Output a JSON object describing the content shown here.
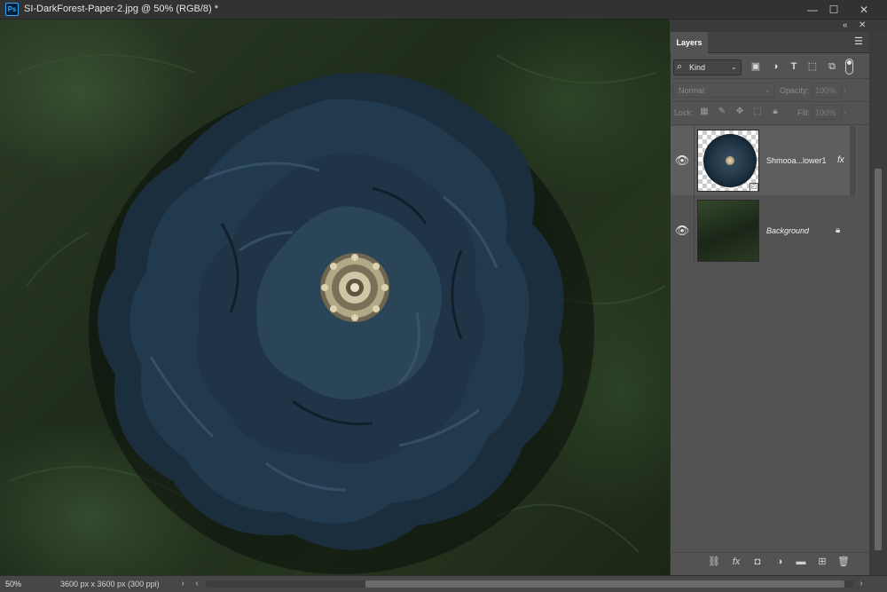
{
  "window": {
    "app_logo": "Ps",
    "title": "SI-DarkForest-Paper-2.jpg @ 50% (RGB/8) *",
    "minimize": "—",
    "maximize": "☐",
    "close": "✕"
  },
  "dock": {
    "collapse": "«",
    "close": "✕"
  },
  "layers_panel": {
    "tab_label": "Layers",
    "menu_icon": "☰",
    "filter": {
      "kind_label": "Kind",
      "icons": [
        "image-filter-icon",
        "adjustment-filter-icon",
        "type-filter-icon",
        "shape-filter-icon",
        "smart-object-filter-icon",
        "filter-toggle-icon"
      ]
    },
    "blend_mode": "Normal",
    "opacity_label": "Opacity:",
    "opacity_value": "100%",
    "lock_label": "Lock:",
    "fill_label": "Fill:",
    "fill_value": "100%",
    "layers": [
      {
        "name": "Shmooa...lower1",
        "visible": true,
        "selected": true,
        "has_fx": true,
        "fx_label": "fx",
        "smart_object": true
      },
      {
        "name": "Background",
        "visible": true,
        "selected": false,
        "locked": true
      }
    ],
    "bottom_icons": [
      "link-layers-icon",
      "fx-icon",
      "add-mask-icon",
      "adjustment-layer-icon",
      "group-folder-icon",
      "new-layer-icon",
      "trash-icon"
    ]
  },
  "status": {
    "zoom": "50%",
    "doc_info": "3600 px x 3600 px (300 ppi)"
  },
  "colors": {
    "panel_bg": "#535353",
    "titlebar_bg": "#323232",
    "flower_blue": "#1d3142",
    "forest_green": "#26351f"
  }
}
